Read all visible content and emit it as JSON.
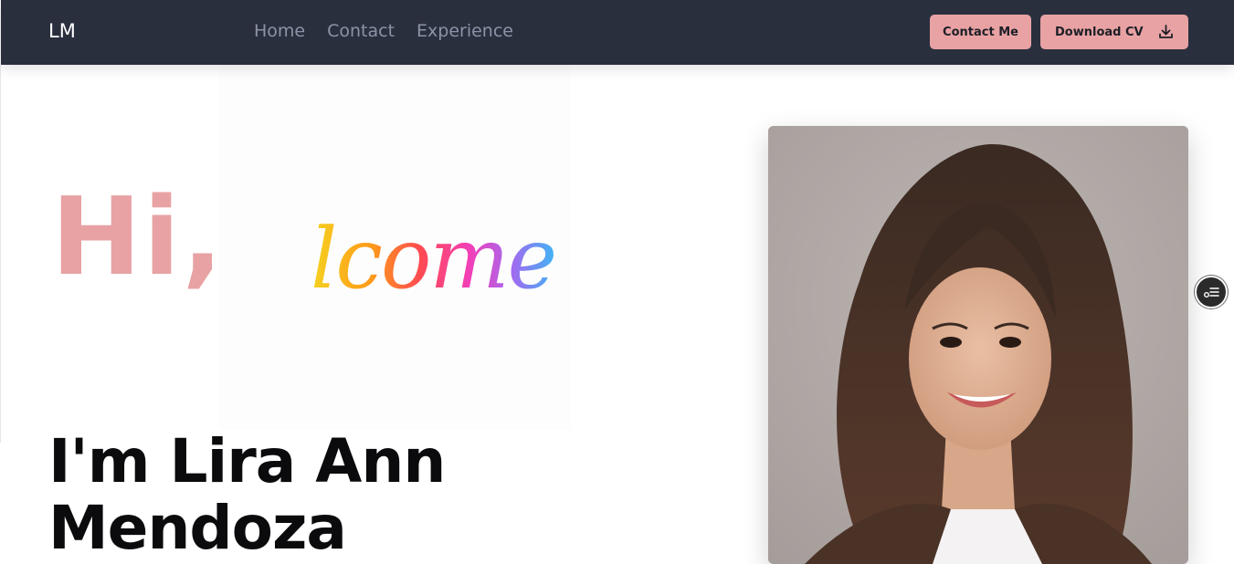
{
  "header": {
    "logo": "LM",
    "nav": [
      "Home",
      "Contact",
      "Experience"
    ],
    "contact_button": "Contact Me",
    "cv_button": "Download CV"
  },
  "hero": {
    "greeting": "Hi,",
    "welcome_script": "lcome",
    "name_line1": "I'm Lira Ann",
    "name_line2": "Mendoza"
  },
  "icons": {
    "download": "download-icon",
    "floating": "filter-list-icon",
    "portrait": "portrait-photo"
  },
  "colors": {
    "navbar": "#2a2f3e",
    "accent": "#e8a2a4",
    "nav_link": "#8b93a6",
    "heading": "#0b0b0d"
  }
}
